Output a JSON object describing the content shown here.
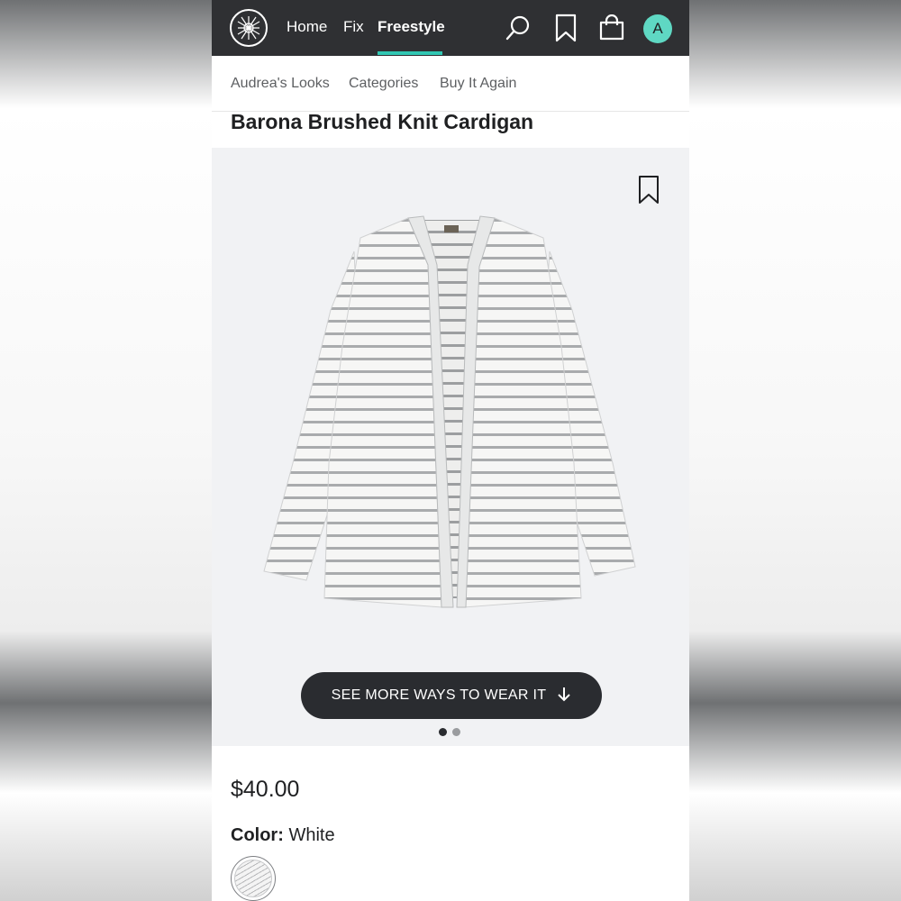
{
  "nav": {
    "links": [
      "Home",
      "Fix",
      "Freestyle"
    ],
    "active": "Freestyle",
    "avatar_initial": "A",
    "accent_color": "#31c7b3",
    "avatar_color": "#5fd8c3",
    "icons": [
      "logo-icon",
      "search-icon",
      "bookmark-icon",
      "bag-icon"
    ]
  },
  "subnav": {
    "items": [
      "Audrea's Looks",
      "Categories",
      "Buy It Again"
    ]
  },
  "product": {
    "name": "Barona Brushed Knit Cardigan",
    "image": "striped-cardigan",
    "carousel": {
      "pages": 2,
      "current": 1
    },
    "wear_button_label": "SEE MORE WAYS TO WEAR IT",
    "price": "$40.00",
    "color_label": "Color:",
    "color_value": "White"
  }
}
